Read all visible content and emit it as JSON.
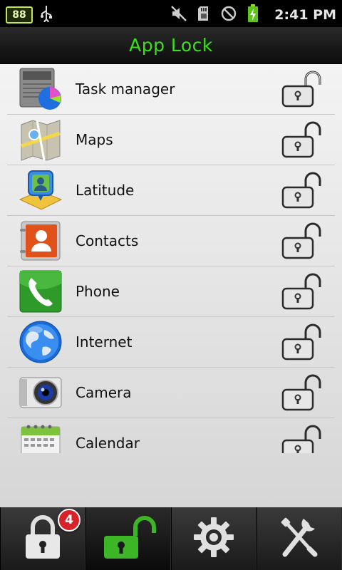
{
  "status_bar": {
    "battery_level": "88",
    "time": "2:41 PM",
    "icons": [
      "battery-icon",
      "usb-icon",
      "mute-icon",
      "sd-card-icon",
      "no-signal-icon",
      "charging-icon"
    ]
  },
  "header": {
    "title": "App Lock"
  },
  "apps": [
    {
      "label": "Task manager",
      "icon": "task-manager-icon",
      "locked": false
    },
    {
      "label": "Maps",
      "icon": "maps-icon",
      "locked": false
    },
    {
      "label": "Latitude",
      "icon": "latitude-icon",
      "locked": false
    },
    {
      "label": "Contacts",
      "icon": "contacts-icon",
      "locked": false
    },
    {
      "label": "Phone",
      "icon": "phone-icon",
      "locked": false
    },
    {
      "label": "Internet",
      "icon": "internet-icon",
      "locked": false
    },
    {
      "label": "Camera",
      "icon": "camera-icon",
      "locked": false
    },
    {
      "label": "Calendar",
      "icon": "calendar-icon",
      "locked": false
    }
  ],
  "tabs": [
    {
      "icon": "padlock-icon",
      "badge": "4",
      "active": false
    },
    {
      "icon": "unlocked-padlock-icon",
      "active": true
    },
    {
      "icon": "gear-icon",
      "active": false
    },
    {
      "icon": "tools-icon",
      "active": false
    }
  ],
  "colors": {
    "title": "#39e21b",
    "tab_unlock": "#3cb526",
    "badge": "#d8222a"
  }
}
